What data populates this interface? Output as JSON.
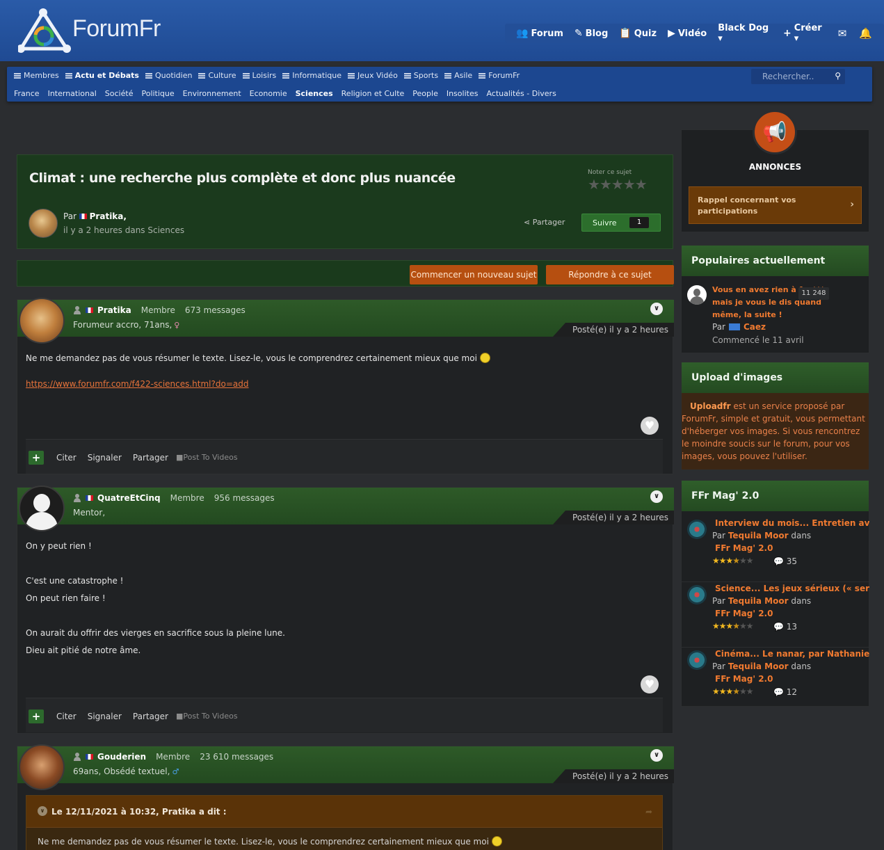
{
  "brand": {
    "logo_text": "ForumFr"
  },
  "topnav": [
    {
      "icon": "users-icon",
      "glyph": "👥",
      "label": "Forum"
    },
    {
      "icon": "feather-icon",
      "glyph": "✎",
      "label": "Blog"
    },
    {
      "icon": "clipboard-icon",
      "glyph": "📋",
      "label": "Quiz"
    },
    {
      "icon": "video-icon",
      "glyph": "▶",
      "label": "Vidéo"
    },
    {
      "icon": "",
      "glyph": "",
      "label": "Black Dog ▾"
    },
    {
      "icon": "plus-icon",
      "glyph": "+",
      "label": "Créer ▾"
    }
  ],
  "topnav_icons": {
    "mail": "✉",
    "bell": "🔔"
  },
  "catnav": {
    "items": [
      "Membres",
      "Actu et Débats",
      "Quotidien",
      "Culture",
      "Loisirs",
      "Informatique",
      "Jeux Vidéo",
      "Sports",
      "Asile",
      "ForumFr"
    ],
    "subitems": [
      "France",
      "International",
      "Société",
      "Politique",
      "Environnement",
      "Economie",
      "Sciences",
      "Religion et Culte",
      "People",
      "Insolites",
      "Actualités - Divers"
    ],
    "search_placeholder": "Rechercher.."
  },
  "topic": {
    "title": "Climat : une recherche plus complète et donc plus nuancée",
    "rate_label": "Noter ce sujet",
    "rating_stars": 0,
    "author_prefix": "Par",
    "author": "Pratika,",
    "date_line": "il y a 2 heures dans Sciences",
    "share_label": "Partager",
    "follow_label": "Suivre",
    "follow_count": "1"
  },
  "actions": {
    "new_topic": "Commencer un nouveau sujet",
    "reply": "Répondre à ce sujet"
  },
  "posts": [
    {
      "username": "Pratika",
      "role": "Membre",
      "messages": "673 messages",
      "title": "Forumeur accro, 71ans,",
      "gender": "♀",
      "posted": "Posté(e) il y a 2 heures",
      "body": [
        "Ne me demandez pas de vous résumer le texte. Lisez-le, vous le comprendrez certainement mieux que moi"
      ],
      "link": "https://www.forumfr.com/f422-sciences.html?do=add"
    },
    {
      "username": "QuatreEtCinq",
      "role": "Membre",
      "messages": "956 messages",
      "title": "Mentor,",
      "posted": "Posté(e) il y a 2 heures",
      "body": [
        "On y peut rien !",
        "",
        "C'est une catastrophe !",
        "On peut rien faire !",
        "",
        "On aurait du offrir des vierges en sacrifice sous la pleine lune.",
        "Dieu ait pitié de notre âme."
      ]
    },
    {
      "username": "Gouderien",
      "role": "Membre",
      "messages": "23 610 messages",
      "title": "69ans, Obsédé textuel,",
      "gender": "♂",
      "posted": "Posté(e) il y a 2 heures",
      "quote_head": "Le 12/11/2021 à 10:32, Pratika a dit :",
      "quote_body": "Ne me demandez pas de vous résumer le texte. Lisez-le, vous le comprendrez certainement mieux que moi"
    }
  ],
  "post_footer": {
    "cite": "Citer",
    "report": "Signaler",
    "share": "Partager",
    "video": "Post To Videos",
    "plus": "+"
  },
  "sidebar": {
    "announcements": {
      "title": "ANNONCES",
      "item": "Rappel concernant vos participations"
    },
    "popular": {
      "title": "Populaires actuellement",
      "topic_title": "Vous en avez rien à fout** mais je vous le dis quand même, la suite !",
      "count": "11 248",
      "by_prefix": "Par",
      "by": "Caez",
      "started": "Commencé le 11 avril"
    },
    "upload": {
      "title": "Upload d'images",
      "brand": "Uploadfr",
      "text": " est un service proposé par ForumFr, simple et gratuit, vous permettant d'héberger vos images. Si vous rencontrez le moindre soucis sur le forum, pour vos images, vous pouvez l'utiliser."
    },
    "mag": {
      "title": "FFr Mag' 2.0",
      "items": [
        {
          "title": "Interview du mois... Entretien ave...",
          "by": "Tequila Moor",
          "cat": "FFr Mag' 2.0",
          "rating": 3.5,
          "comments": "35"
        },
        {
          "title": "Science... Les jeux sérieux (« serio...",
          "by": "Tequila Moor",
          "cat": "FFr Mag' 2.0",
          "rating": 3.5,
          "comments": "13"
        },
        {
          "title": "Cinéma... Le nanar, par Nathaniel",
          "by": "Tequila Moor",
          "cat": "FFr Mag' 2.0",
          "rating": 3.5,
          "comments": "12"
        }
      ],
      "by_prefix": "Par",
      "in_label": "dans"
    }
  },
  "colors": {
    "header_blue": "#2a5ba8",
    "green_band": "#2e5a28",
    "orange": "#b64f10",
    "link_orange": "#f07a30"
  }
}
